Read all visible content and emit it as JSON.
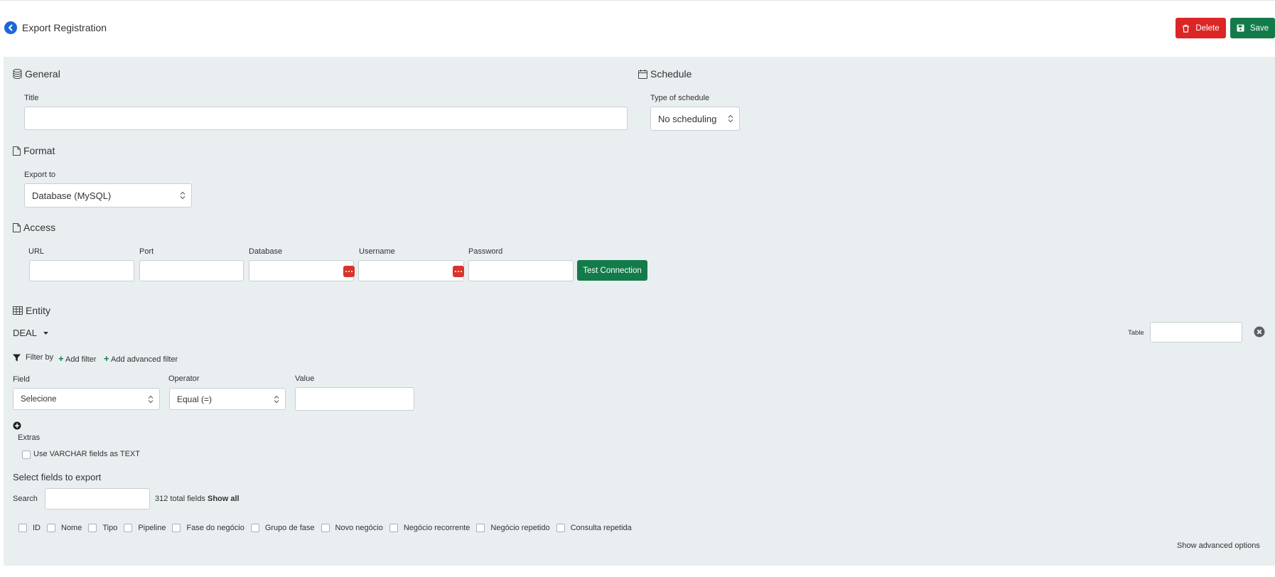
{
  "header": {
    "title": "Export Registration",
    "delete_label": "Delete",
    "save_label": "Save"
  },
  "general": {
    "title": "General",
    "title_label": "Title",
    "title_value": ""
  },
  "schedule": {
    "title": "Schedule",
    "type_label": "Type of schedule",
    "type_value": "No scheduling"
  },
  "format": {
    "title": "Format",
    "export_label": "Export to",
    "export_value": "Database (MySQL)"
  },
  "access": {
    "title": "Access",
    "url_label": "URL",
    "port_label": "Port",
    "database_label": "Database",
    "username_label": "Username",
    "password_label": "Password",
    "test_label": "Test Connection"
  },
  "entity": {
    "title": "Entity",
    "selected": "DEAL",
    "table_label": "Table",
    "filter_by_label": "Filter by",
    "add_filter_label": "Add filter",
    "add_advanced_filter_label": "Add advanced filter",
    "field_label": "Field",
    "field_value": "Selecione",
    "operator_label": "Operator",
    "operator_value": "Equal (=)",
    "value_label": "Value",
    "extras_label": "Extras",
    "varchar_label": "Use VARCHAR fields as TEXT"
  },
  "fields": {
    "title": "Select fields to export",
    "search_label": "Search",
    "total_text": "312 total fields",
    "show_all_label": "Show all",
    "items": [
      "ID",
      "Nome",
      "Tipo",
      "Pipeline",
      "Fase do negócio",
      "Grupo de fase",
      "Novo negócio",
      "Negócio recorrente",
      "Negócio repetido",
      "Consulta repetida"
    ],
    "advanced_label": "Show advanced options"
  },
  "colors": {
    "primary": "#1a66d9",
    "danger": "#dc2626",
    "success": "#137b4a",
    "panel_bg": "#e9eef1"
  }
}
